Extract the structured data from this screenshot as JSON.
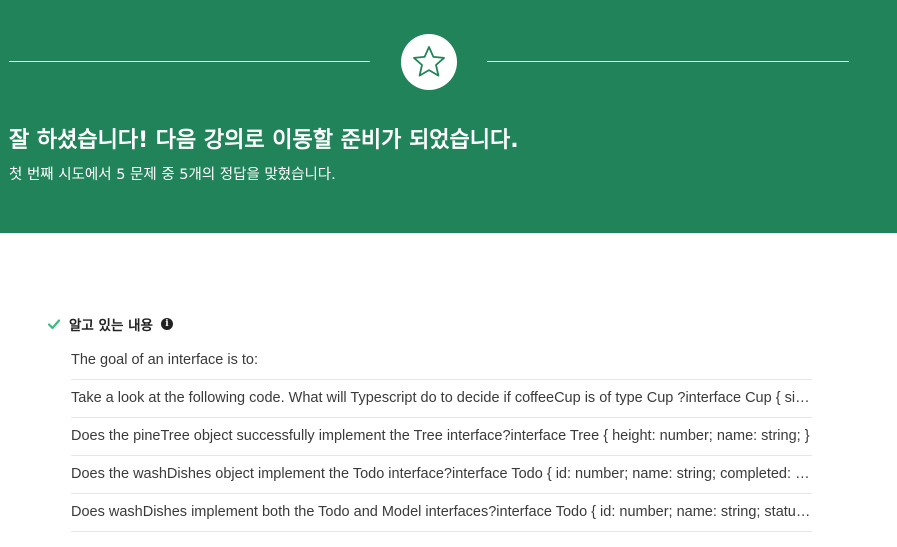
{
  "banner": {
    "headline": "잘 하셨습니다! 다음 강의로 이동할 준비가 되었습니다.",
    "subline": "첫 번째 시도에서 5 문제 중 5개의 정답을 맞혔습니다.",
    "badge_icon": "star-icon",
    "background_color": "#21835a"
  },
  "results": {
    "section_title": "알고 있는 내용",
    "status_icon": "check-icon",
    "info_icon": "info-icon",
    "accent_color": "#3dba7c",
    "questions": [
      "The goal of an interface is to:",
      "Take a look at the following code.  What will Typescript do to decide if coffeeCup is of type Cup ?interface Cup { size: string; strength: number; sugars: number; }",
      "Does the pineTree object successfully implement the Tree interface?interface Tree { height: number; name: string; }",
      "Does the washDishes object implement the Todo interface?interface Todo { id: number; name: string; completed: boolean; }",
      "Does washDishes implement both the Todo and Model interfaces?interface Todo { id: number; name: string; status: string; }"
    ]
  }
}
